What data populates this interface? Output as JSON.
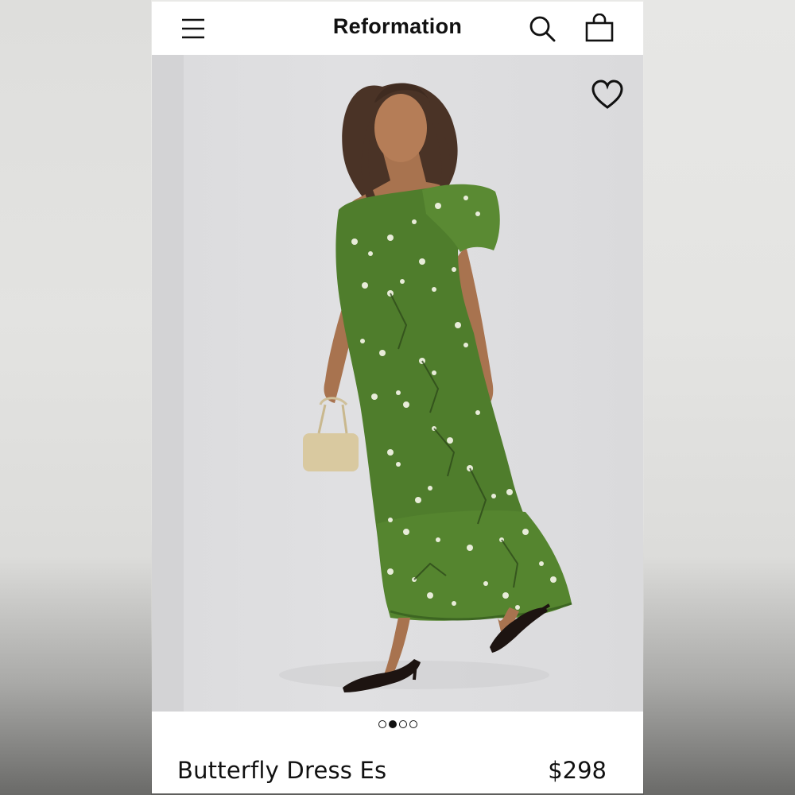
{
  "header": {
    "brand": "Reformation",
    "menu_icon": "hamburger-menu-icon",
    "search_icon": "search-icon",
    "bag_icon": "shopping-bag-icon"
  },
  "product": {
    "wishlist_icon": "heart-icon",
    "image_description_icon": "product-photo",
    "name": "Butterfly Dress Es",
    "price": "$298",
    "carousel": {
      "total": 4,
      "active_index": 1
    }
  },
  "colors": {
    "dress_green": "#4f7d2c",
    "background": "#e0e0e2",
    "text": "#111111"
  }
}
